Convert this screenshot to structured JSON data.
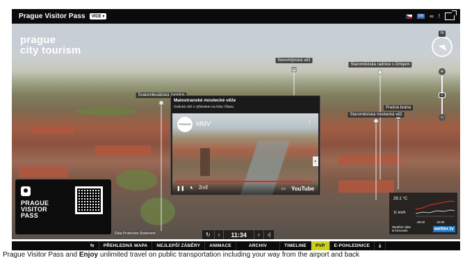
{
  "header": {
    "title": "Prague Visitor Pass",
    "more_label": "VÍCE ▾",
    "icons": [
      "flag-cz-icon",
      "flag-en-icon",
      "infinity-icon",
      "info-icon",
      "fullscreen-icon"
    ],
    "infinity": "∞",
    "info": "!"
  },
  "brand": {
    "line1": "prague",
    "line2": "city tourism"
  },
  "pois": [
    {
      "label": "Novomlýnská věž"
    },
    {
      "label": "Staroměstská radnice s Orlojem"
    },
    {
      "label": "Svatomikulášská zvonice"
    },
    {
      "label": "Prašná brána"
    },
    {
      "label": "Staroměstská mostecká věž"
    }
  ],
  "compass": {
    "n": "N"
  },
  "zoom": {
    "in": "+",
    "out": "−"
  },
  "video": {
    "title": "Malostranské mostecké věže",
    "subtitle": "Gotická věž s výhledem na řeku Vltavu",
    "channel": "MMV",
    "live_label": "ŽIVĚ",
    "youtube_label": "YouTube",
    "progress": 1.0
  },
  "ad": {
    "line1": "PRAGUE",
    "line2": "VISITOR",
    "line3": "PASS"
  },
  "data_protection": "Data Protection Statement",
  "weather": {
    "temperature": "28.1 °C",
    "wind": "11 km/h",
    "time1": "08:00",
    "time2": "10:00",
    "label_line1": "Weather data",
    "label_line2": "& forecasts",
    "brand": "wetter.tv"
  },
  "timebar": {
    "time": "11:34",
    "prev": "‹",
    "next": "›",
    "last": "›|",
    "rewind": "↻"
  },
  "menu": {
    "items": [
      {
        "label": "⇆",
        "active": false
      },
      {
        "label": "PŘEHLEDNÁ MAPA",
        "active": false
      },
      {
        "label": "NEJLEPŠÍ ZÁBĚRY",
        "active": false
      },
      {
        "label": "ANIMACE",
        "active": false
      },
      {
        "label": "ARCHIV",
        "active": false
      },
      {
        "label": "TIMELINE",
        "active": false
      },
      {
        "label": "PVP",
        "active": true
      },
      {
        "label": "E-POHLEDNICE",
        "active": false
      },
      {
        "label": "⤓",
        "active": false
      }
    ]
  },
  "tagline": {
    "part1": "Prague Visitor Pass and ",
    "bold": "Enjoy",
    "part2": " unlimited travel on public transportation including your way from the airport and back"
  },
  "colors": {
    "accent": "#c8cf1f",
    "bar": "#0b0b0b",
    "wetter": "#1d76c3"
  }
}
